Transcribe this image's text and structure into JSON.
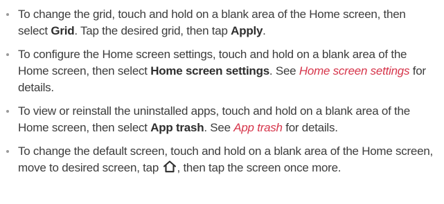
{
  "bullets": [
    {
      "p1": "To change the grid, touch and hold on a blank area of the Home screen, then select ",
      "b1": "Grid",
      "p2": ". Tap the desired grid, then tap ",
      "b2": "Apply",
      "p3": "."
    },
    {
      "p1": "To configure the Home screen settings, touch and hold on a blank area of the Home screen, then select ",
      "b1": "Home screen settings",
      "p2": ". See ",
      "link": "Home screen settings",
      "p3": " for details."
    },
    {
      "p1": "To view or reinstall the uninstalled apps, touch and hold on a blank area of the Home screen, then select ",
      "b1": "App trash",
      "p2": ". See ",
      "link": "App trash",
      "p3": " for details."
    },
    {
      "p1": "To change the default screen, touch and hold on a blank area of the Home screen, move to desired screen, tap ",
      "icon": "home-icon",
      "p2": ", then tap the screen once more."
    }
  ],
  "colors": {
    "text": "#3c3c3c",
    "bold": "#2e2e2e",
    "link": "#d6354b",
    "bullet": "#9a9a9a"
  }
}
